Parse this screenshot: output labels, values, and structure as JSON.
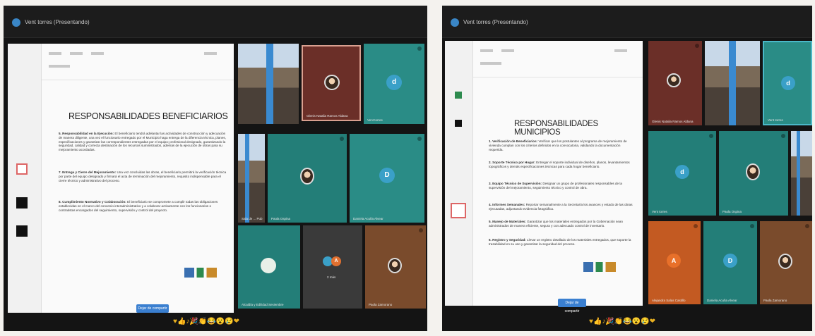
{
  "left_screen": {
    "window_title": "Vent torres (Presentando)",
    "doc_title": "RESPONSABILIDADES BENEFICIARIOS",
    "items": [
      {
        "heading": "5. Responsabilidad en la Ejecución:",
        "text": "El beneficiario tendrá adelantar las actividades de construcción y adecuación de manera diligente, una vez el funcionario entregado por el Municipio haga entrega de la diferencia técnica, planes, especificaciones y garantizar las correspondientes entregadas por el equipo; profesional designado, garantizando la seguridad, calidad y correcta destinación de los recursos suministrados, además de la ejecución de obras para su mejoramiento acordadas."
      },
      {
        "heading": "7. Entrega y Cierre del Mejoramiento:",
        "text": "Una vez concluidas las obras, el beneficiario permitirá la verificación técnica por parte del equipo designado y firmará el acta de terminación del mejoramiento, requisito indispensable para el cierre técnico y administrativo del proceso."
      },
      {
        "heading": "8. Cumplimiento Normativo y Colaboración:",
        "text": "El beneficiario se compromete a cumplir todas las obligaciones establecidas en el marco del convenio interadministrativo y a colaborar activamente con los funcionarios o contratistas encargados del seguimiento, supervisión y control del proyecto."
      }
    ],
    "doc_button": "Dejar de compartir",
    "tiles": [
      {
        "name": ""
      },
      {
        "name": "Glenis Natalia Ramos Aldana"
      },
      {
        "name": "Vent torres",
        "initial": "d"
      },
      {
        "name": "Sala de ... Pub"
      },
      {
        "name": "Paola Ospina"
      },
      {
        "name": "Daniela Acuña Alvear",
        "initial": "D"
      },
      {
        "name": "Alcaldía y Edilidad Sesiembre"
      },
      {
        "name": "2 más"
      },
      {
        "name": "Paola Zamorano"
      }
    ],
    "reactions": "♥👍♪🎉👏😂😮😢❤"
  },
  "right_screen": {
    "window_title": "Vent torres (Presentando)",
    "doc_title": "RESPONSABILIDADES MUNICIPIOS",
    "items": [
      {
        "heading": "1. Verificación de Beneficiarios:",
        "text": "Verificar que los postulantes al programa de mejoramiento de vivienda cumplan con los criterios definidos en la convocatoria, validando la documentación requerida."
      },
      {
        "heading": "2. Soporte Técnico por Hogar:",
        "text": "Entregar el soporte individual de diseños, planos, levantamientos topográficos y demás especificaciones técnicas para cada hogar beneficiario."
      },
      {
        "heading": "3. Equipo Técnico de Supervisión:",
        "text": "Designar un grupo de profesionales responsables de la supervisión del mejoramiento, seguimiento técnico y control de obra."
      },
      {
        "heading": "4. Informes Semanales:",
        "text": "Reportar semanalmente a la Secretaría los avances y estado de las obras ejecutadas, adjuntando evidencia fotográfica."
      },
      {
        "heading": "5. Manejo de Materiales:",
        "text": "Garantizar que los materiales entregados por la Gobernación sean administrados de manera eficiente, segura y con adecuado control de inventario."
      },
      {
        "heading": "6. Registro y Seguridad:",
        "text": "Llevar un registro detallado de los materiales entregados, que soporte la trazabilidad en su uso y garantizar la seguridad del proceso."
      }
    ],
    "doc_button": "Dejar de compartir",
    "tiles": [
      {
        "name": "Glenis Natalia Ramos Aldana"
      },
      {
        "name": ""
      },
      {
        "name": "Vent torres",
        "initial": "d"
      },
      {
        "name": "Vent torres",
        "initial": "d"
      },
      {
        "name": "Paola Ospina"
      },
      {
        "name": ""
      },
      {
        "name": "Alejandra Salas Castillo",
        "initial": "A"
      },
      {
        "name": "Daniela Acuña Alvear",
        "initial": "D"
      },
      {
        "name": "Paola Zamorano"
      }
    ],
    "reactions": "♥👍♪🎉👏😂😮😢❤"
  },
  "colors": {
    "teal": "#237e78",
    "orange": "#c35a22",
    "brown": "#7a4b2c",
    "doc_background": "#fafafa",
    "call_background": "#141414"
  }
}
